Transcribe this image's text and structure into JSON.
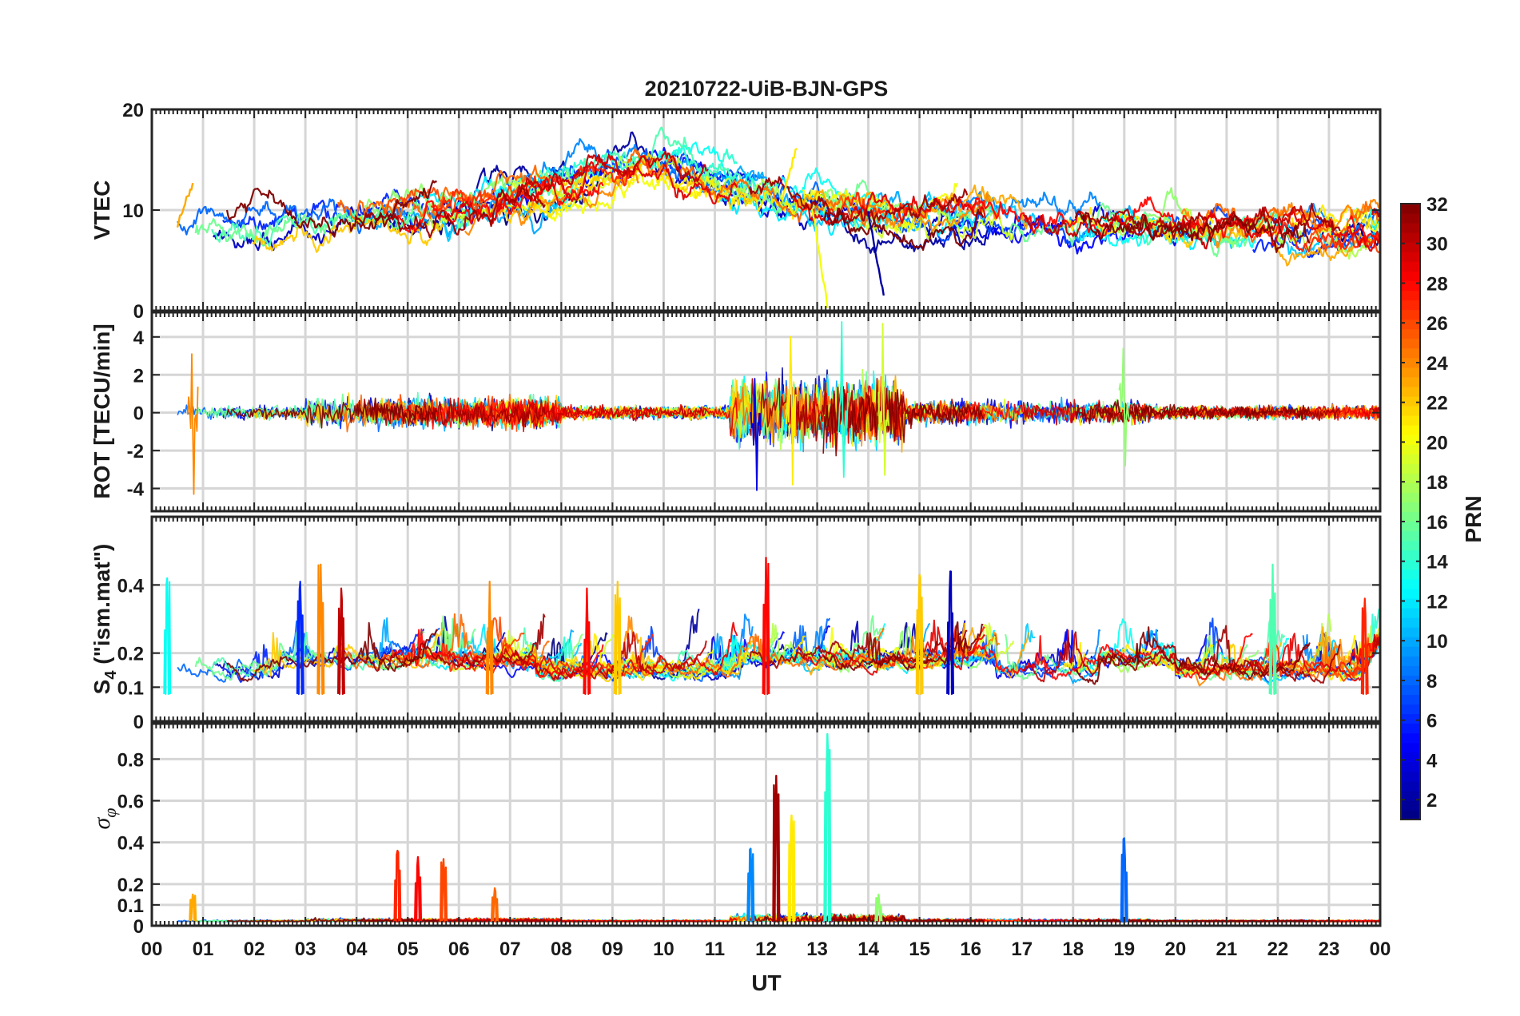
{
  "chart_data": {
    "type": "line",
    "title": "20210722-UiB-BJN-GPS",
    "xlabel": "UT",
    "x_tick_labels": [
      "00",
      "01",
      "02",
      "03",
      "04",
      "05",
      "06",
      "07",
      "08",
      "09",
      "10",
      "11",
      "12",
      "13",
      "14",
      "15",
      "16",
      "17",
      "18",
      "19",
      "20",
      "21",
      "22",
      "23",
      "00"
    ],
    "xlim": [
      0,
      24
    ],
    "grid": true,
    "colorbar": {
      "label": "PRN",
      "colormap": "jet",
      "range": [
        1,
        32
      ],
      "tick_labels": [
        "2",
        "4",
        "6",
        "8",
        "10",
        "12",
        "14",
        "16",
        "18",
        "20",
        "22",
        "24",
        "26",
        "28",
        "30",
        "32"
      ]
    },
    "panels": [
      {
        "ylabel": "VTEC",
        "ylim": [
          0,
          20
        ],
        "y_tick_labels": [
          "0",
          "10",
          "20"
        ],
        "baseline_profile": {
          "hours": [
            0,
            1,
            2,
            3,
            4,
            5,
            6,
            7,
            8,
            9,
            10,
            11,
            12,
            13,
            14,
            15,
            16,
            17,
            18,
            19,
            20,
            21,
            22,
            23,
            24
          ],
          "values": [
            8.3,
            8.4,
            8.6,
            8.9,
            9.2,
            9.6,
            10.1,
            10.8,
            12.0,
            13.6,
            13.9,
            12.6,
            11.2,
            10.2,
            9.7,
            9.4,
            9.2,
            9.0,
            8.7,
            8.5,
            8.3,
            8.1,
            7.9,
            7.8,
            7.7
          ]
        },
        "features": [
          {
            "note": "drop to near 0",
            "hour": 13.2,
            "value": 0.5,
            "prn": 20
          },
          {
            "note": "drop",
            "hour": 14.3,
            "value": 1.5,
            "prn": 2
          },
          {
            "note": "spike",
            "hour": 12.6,
            "value": 16.2,
            "prn": 21
          },
          {
            "note": "spike",
            "hour": 0.8,
            "value": 12.8,
            "prn": 23
          }
        ]
      },
      {
        "ylabel": "ROT [TECU/min]",
        "ylim": [
          -5.2,
          5.3
        ],
        "y_tick_labels": [
          "-4",
          "-2",
          "0",
          "2",
          "4"
        ],
        "extremes": [
          {
            "hour": 0.8,
            "min": -4.3,
            "max": 3.1,
            "prn": 24
          },
          {
            "hour": 11.8,
            "min": -4.1,
            "max": 1.8,
            "prn": 4
          },
          {
            "hour": 12.5,
            "min": -3.8,
            "max": 4.0,
            "prn": 21
          },
          {
            "hour": 13.5,
            "min": -3.4,
            "max": 4.8,
            "prn": 14
          },
          {
            "hour": 14.3,
            "min": -3.3,
            "max": 4.7,
            "prn": 19
          },
          {
            "hour": 19.0,
            "min": -2.8,
            "max": 3.4,
            "prn": 17
          }
        ]
      },
      {
        "ylabel": "S4 (\"ism.mat\")",
        "ylim": [
          0,
          0.6
        ],
        "y_tick_labels": [
          "0",
          "0.1",
          "0.2",
          "0.4"
        ],
        "peaks": [
          {
            "hour": 0.3,
            "value": 0.42,
            "prn": 13
          },
          {
            "hour": 3.3,
            "value": 0.46,
            "prn": 24
          },
          {
            "hour": 2.9,
            "value": 0.41,
            "prn": 6
          },
          {
            "hour": 3.7,
            "value": 0.39,
            "prn": 30
          },
          {
            "hour": 6.6,
            "value": 0.41,
            "prn": 24
          },
          {
            "hour": 8.5,
            "value": 0.39,
            "prn": 28
          },
          {
            "hour": 9.1,
            "value": 0.41,
            "prn": 22
          },
          {
            "hour": 12.0,
            "value": 0.48,
            "prn": 28
          },
          {
            "hour": 15.0,
            "value": 0.43,
            "prn": 22
          },
          {
            "hour": 15.6,
            "value": 0.44,
            "prn": 3
          },
          {
            "hour": 21.9,
            "value": 0.46,
            "prn": 15
          },
          {
            "hour": 23.7,
            "value": 0.36,
            "prn": 27
          }
        ]
      },
      {
        "ylabel": "σ_φ",
        "ylim": [
          0,
          0.97
        ],
        "y_tick_labels": [
          "0",
          "0.1",
          "0.2",
          "0.4",
          "0.6",
          "0.8"
        ],
        "peaks": [
          {
            "hour": 0.8,
            "value": 0.15,
            "prn": 23
          },
          {
            "hour": 4.8,
            "value": 0.36,
            "prn": 27
          },
          {
            "hour": 5.2,
            "value": 0.33,
            "prn": 28
          },
          {
            "hour": 5.7,
            "value": 0.32,
            "prn": 26
          },
          {
            "hour": 6.7,
            "value": 0.18,
            "prn": 25
          },
          {
            "hour": 11.7,
            "value": 0.37,
            "prn": 9
          },
          {
            "hour": 12.2,
            "value": 0.72,
            "prn": 31
          },
          {
            "hour": 12.5,
            "value": 0.53,
            "prn": 21
          },
          {
            "hour": 13.2,
            "value": 0.92,
            "prn": 14
          },
          {
            "hour": 14.2,
            "value": 0.15,
            "prn": 17
          },
          {
            "hour": 19.0,
            "value": 0.42,
            "prn": 8
          }
        ]
      }
    ]
  }
}
